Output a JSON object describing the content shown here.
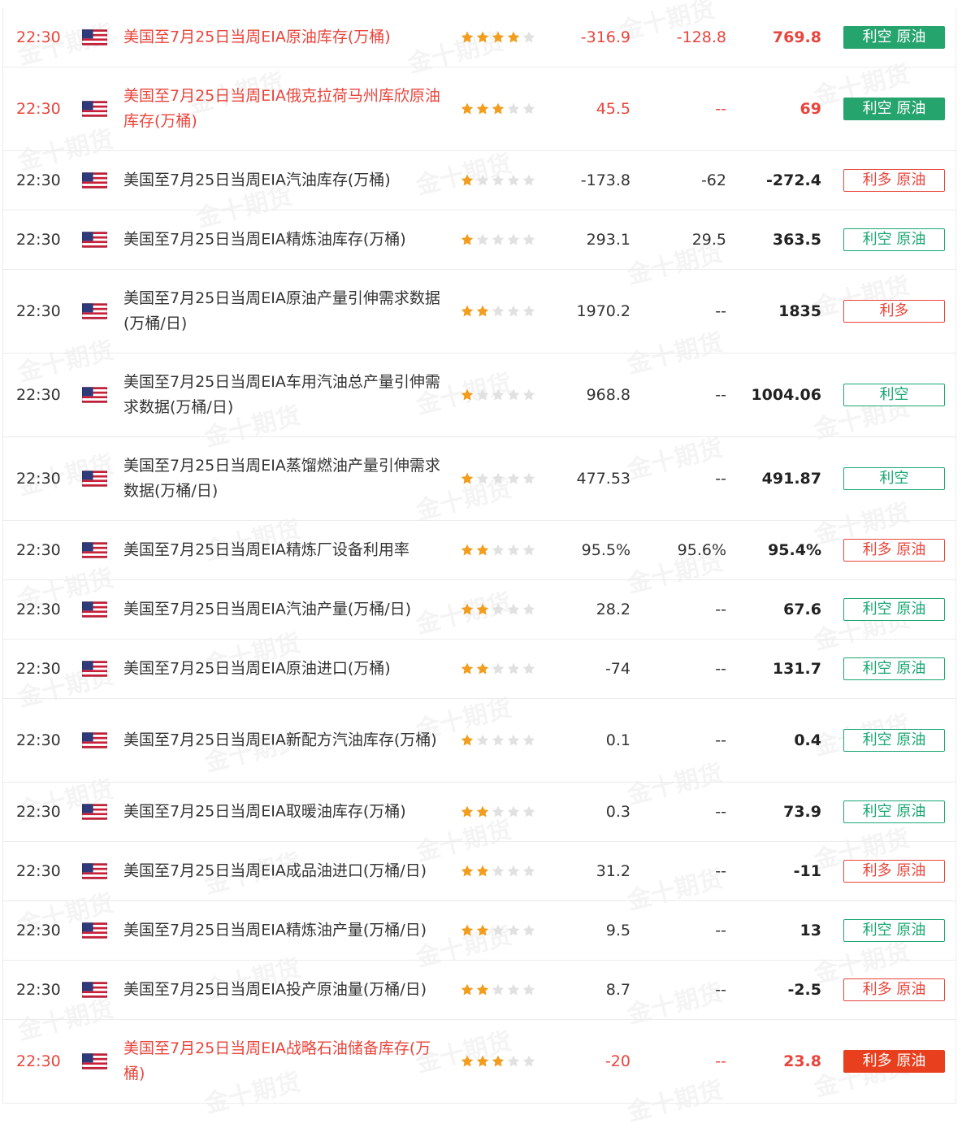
{
  "watermark_text": "金十期货",
  "colors": {
    "highlight_red": "#e8453c",
    "star_active": "#f29d1e",
    "star_inactive": "#e1e1e1",
    "bearish_green": "#26a46e",
    "bullish_red": "#e8401e"
  },
  "rows": [
    {
      "time": "22:30",
      "country_icon": "us-flag-icon",
      "name": "美国至7月25日当周EIA原油库存(万桶)",
      "stars": 4,
      "previous": "-316.9",
      "forecast": "-128.8",
      "actual": "769.8",
      "impact": "利空 原油",
      "impact_style": "solid-green",
      "highlight": true
    },
    {
      "time": "22:30",
      "country_icon": "us-flag-icon",
      "name": "美国至7月25日当周EIA俄克拉荷马州库欣原油库存(万桶)",
      "stars": 3,
      "previous": "45.5",
      "forecast": "--",
      "actual": "69",
      "impact": "利空 原油",
      "impact_style": "solid-green",
      "highlight": true
    },
    {
      "time": "22:30",
      "country_icon": "us-flag-icon",
      "name": "美国至7月25日当周EIA汽油库存(万桶)",
      "stars": 1,
      "previous": "-173.8",
      "forecast": "-62",
      "actual": "-272.4",
      "impact": "利多 原油",
      "impact_style": "outline-red",
      "highlight": false
    },
    {
      "time": "22:30",
      "country_icon": "us-flag-icon",
      "name": "美国至7月25日当周EIA精炼油库存(万桶)",
      "stars": 1,
      "previous": "293.1",
      "forecast": "29.5",
      "actual": "363.5",
      "impact": "利空 原油",
      "impact_style": "outline-green",
      "highlight": false
    },
    {
      "time": "22:30",
      "country_icon": "us-flag-icon",
      "name": "美国至7月25日当周EIA原油产量引伸需求数据(万桶/日)",
      "stars": 2,
      "previous": "1970.2",
      "forecast": "--",
      "actual": "1835",
      "impact": "利多",
      "impact_style": "outline-red",
      "highlight": false
    },
    {
      "time": "22:30",
      "country_icon": "us-flag-icon",
      "name": "美国至7月25日当周EIA车用汽油总产量引伸需求数据(万桶/日)",
      "stars": 1,
      "previous": "968.8",
      "forecast": "--",
      "actual": "1004.06",
      "impact": "利空",
      "impact_style": "outline-green",
      "highlight": false
    },
    {
      "time": "22:30",
      "country_icon": "us-flag-icon",
      "name": "美国至7月25日当周EIA蒸馏燃油产量引伸需求数据(万桶/日)",
      "stars": 1,
      "previous": "477.53",
      "forecast": "--",
      "actual": "491.87",
      "impact": "利空",
      "impact_style": "outline-green",
      "highlight": false
    },
    {
      "time": "22:30",
      "country_icon": "us-flag-icon",
      "name": "美国至7月25日当周EIA精炼厂设备利用率",
      "stars": 2,
      "previous": "95.5%",
      "forecast": "95.6%",
      "actual": "95.4%",
      "impact": "利多 原油",
      "impact_style": "outline-red",
      "highlight": false
    },
    {
      "time": "22:30",
      "country_icon": "us-flag-icon",
      "name": "美国至7月25日当周EIA汽油产量(万桶/日)",
      "stars": 2,
      "previous": "28.2",
      "forecast": "--",
      "actual": "67.6",
      "impact": "利空 原油",
      "impact_style": "outline-green",
      "highlight": false
    },
    {
      "time": "22:30",
      "country_icon": "us-flag-icon",
      "name": "美国至7月25日当周EIA原油进口(万桶)",
      "stars": 2,
      "previous": "-74",
      "forecast": "--",
      "actual": "131.7",
      "impact": "利空 原油",
      "impact_style": "outline-green",
      "highlight": false
    },
    {
      "time": "22:30",
      "country_icon": "us-flag-icon",
      "name": "美国至7月25日当周EIA新配方汽油库存(万桶)",
      "stars": 1,
      "previous": "0.1",
      "forecast": "--",
      "actual": "0.4",
      "impact": "利空 原油",
      "impact_style": "outline-green",
      "highlight": false
    },
    {
      "time": "22:30",
      "country_icon": "us-flag-icon",
      "name": "美国至7月25日当周EIA取暖油库存(万桶)",
      "stars": 2,
      "previous": "0.3",
      "forecast": "--",
      "actual": "73.9",
      "impact": "利空 原油",
      "impact_style": "outline-green",
      "highlight": false
    },
    {
      "time": "22:30",
      "country_icon": "us-flag-icon",
      "name": "美国至7月25日当周EIA成品油进口(万桶/日)",
      "stars": 2,
      "previous": "31.2",
      "forecast": "--",
      "actual": "-11",
      "impact": "利多 原油",
      "impact_style": "outline-red",
      "highlight": false
    },
    {
      "time": "22:30",
      "country_icon": "us-flag-icon",
      "name": "美国至7月25日当周EIA精炼油产量(万桶/日)",
      "stars": 2,
      "previous": "9.5",
      "forecast": "--",
      "actual": "13",
      "impact": "利空 原油",
      "impact_style": "outline-green",
      "highlight": false
    },
    {
      "time": "22:30",
      "country_icon": "us-flag-icon",
      "name": "美国至7月25日当周EIA投产原油量(万桶/日)",
      "stars": 2,
      "previous": "8.7",
      "forecast": "--",
      "actual": "-2.5",
      "impact": "利多 原油",
      "impact_style": "outline-red",
      "highlight": false
    },
    {
      "time": "22:30",
      "country_icon": "us-flag-icon",
      "name": "美国至7月25日当周EIA战略石油储备库存(万桶)",
      "stars": 3,
      "previous": "-20",
      "forecast": "--",
      "actual": "23.8",
      "impact": "利多 原油",
      "impact_style": "solid-red",
      "highlight": true
    }
  ]
}
